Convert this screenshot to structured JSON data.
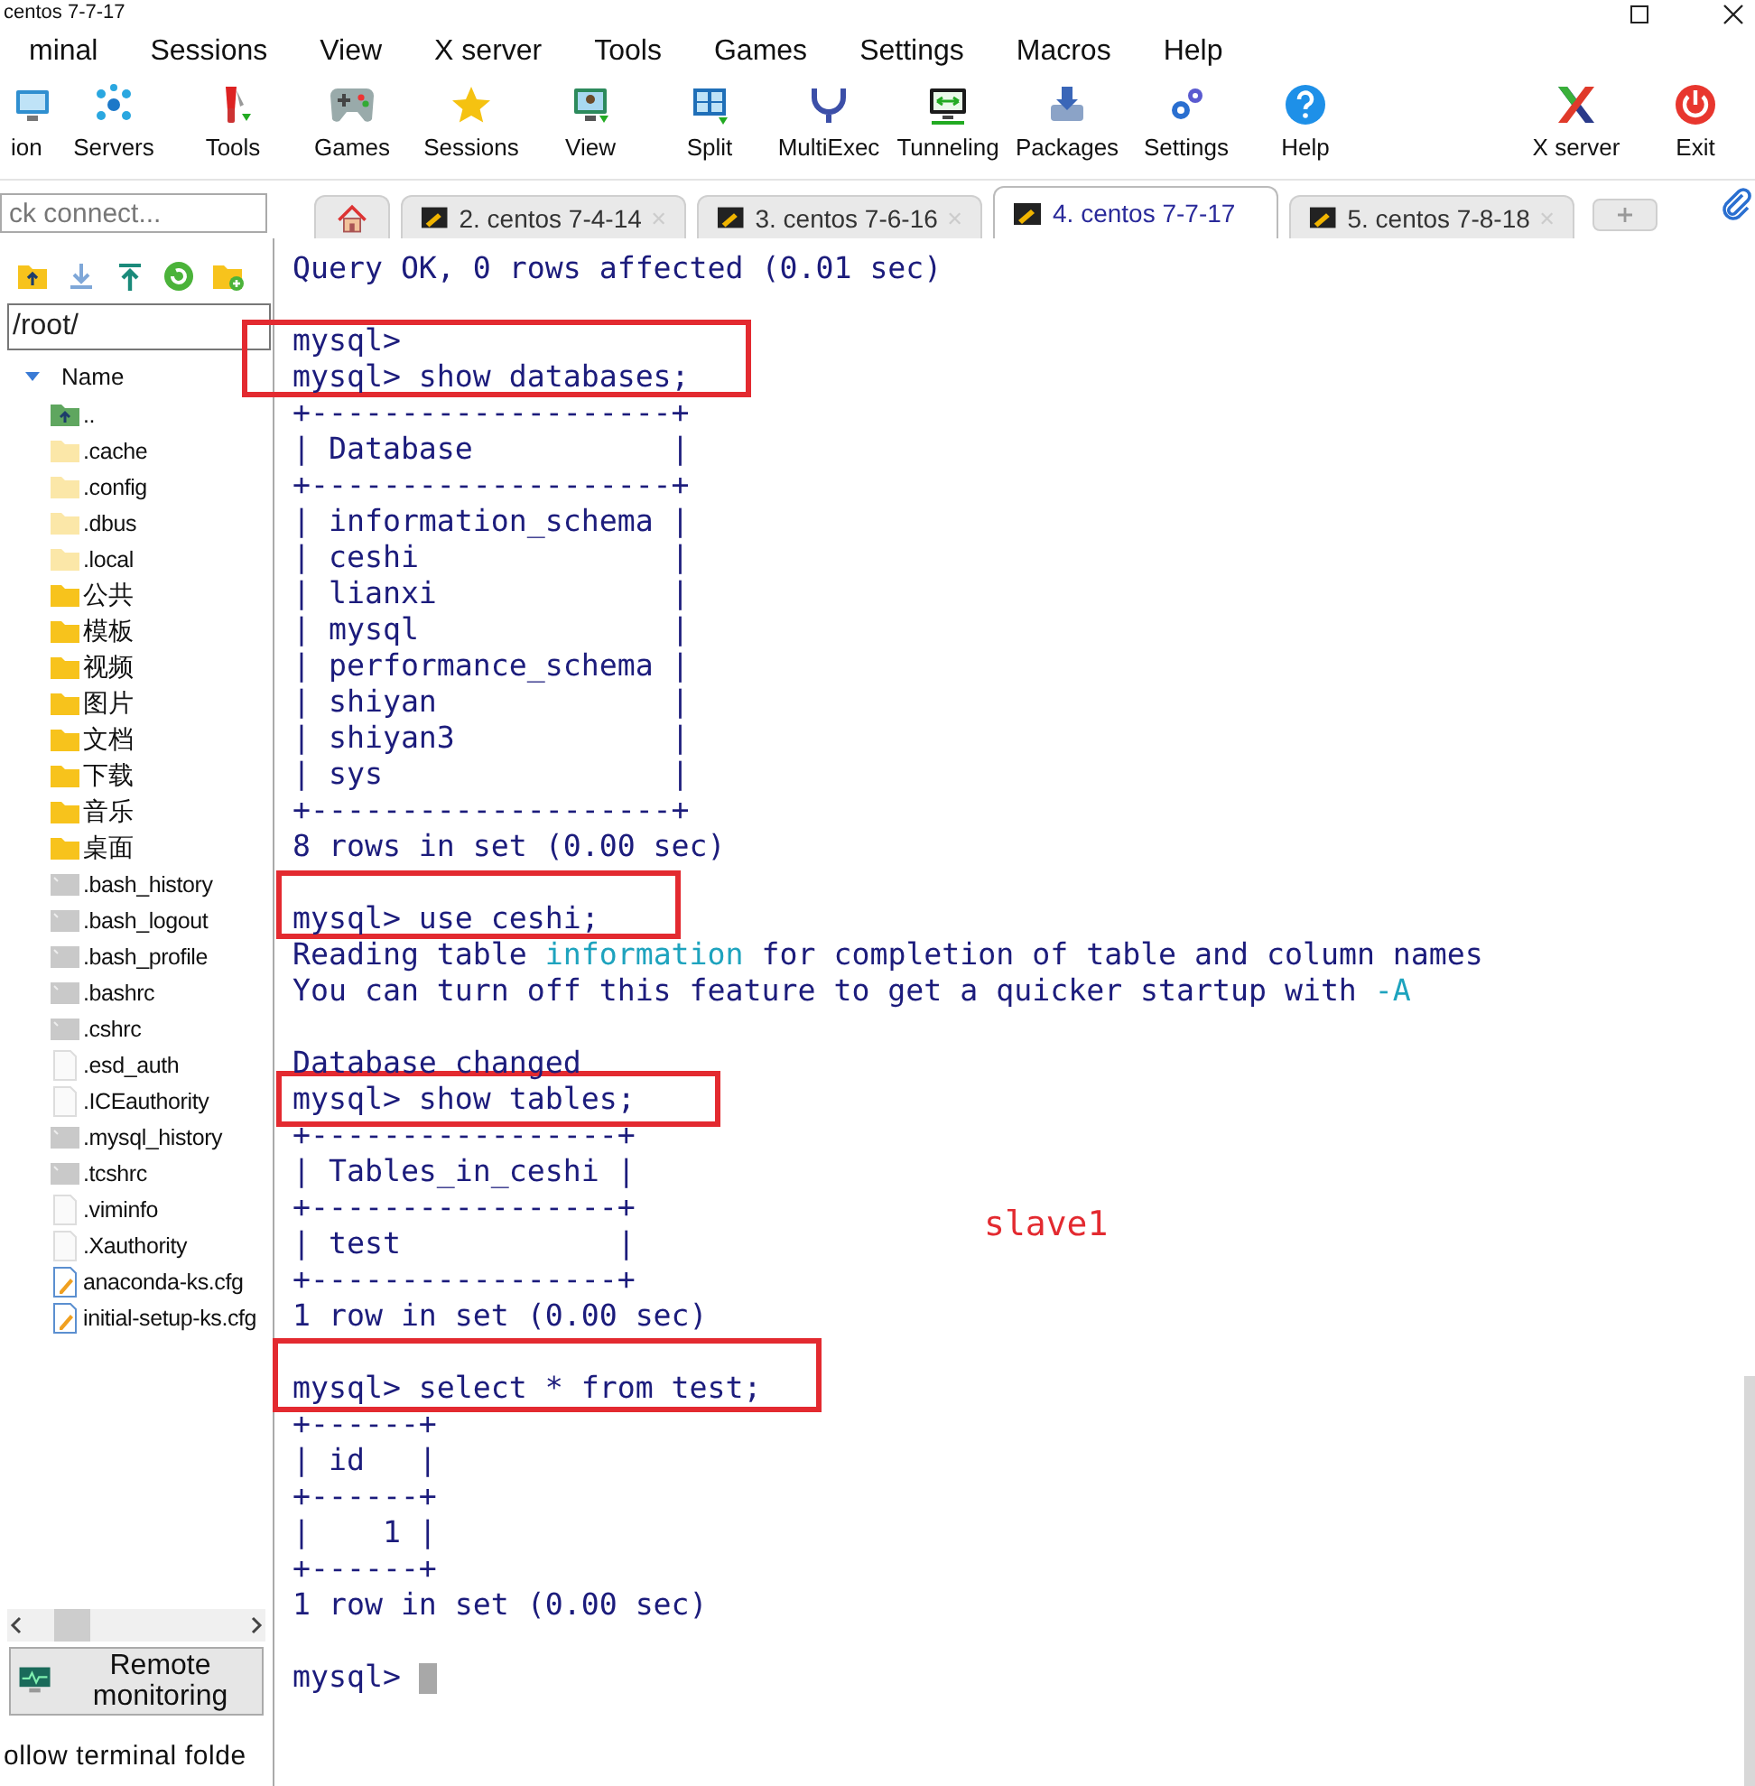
{
  "window": {
    "title": "centos 7-7-17"
  },
  "menu": [
    "minal",
    "Sessions",
    "View",
    "X server",
    "Tools",
    "Games",
    "Settings",
    "Macros",
    "Help"
  ],
  "toolbar": [
    {
      "label": "ion"
    },
    {
      "label": "Servers"
    },
    {
      "label": "Tools"
    },
    {
      "label": "Games"
    },
    {
      "label": "Sessions"
    },
    {
      "label": "View"
    },
    {
      "label": "Split"
    },
    {
      "label": "MultiExec"
    },
    {
      "label": "Tunneling"
    },
    {
      "label": "Packages"
    },
    {
      "label": "Settings"
    },
    {
      "label": "Help"
    },
    {
      "label": "X server"
    },
    {
      "label": "Exit"
    }
  ],
  "quick_connect": {
    "placeholder": "ck connect..."
  },
  "tabs": [
    {
      "kind": "home",
      "selected": false
    },
    {
      "kind": "session",
      "label": "2. centos 7-4-14",
      "selected": false
    },
    {
      "kind": "session",
      "label": "3. centos 7-6-16",
      "selected": false
    },
    {
      "kind": "session",
      "label": "4. centos 7-7-17",
      "selected": true
    },
    {
      "kind": "session",
      "label": "5. centos 7-8-18",
      "selected": false
    },
    {
      "kind": "new",
      "selected": false
    }
  ],
  "sidebar": {
    "path": "/root/",
    "column": "Name",
    "files": [
      {
        "name": "..",
        "kind": "up"
      },
      {
        "name": ".cache",
        "kind": "hidden-folder"
      },
      {
        "name": ".config",
        "kind": "hidden-folder"
      },
      {
        "name": ".dbus",
        "kind": "hidden-folder"
      },
      {
        "name": ".local",
        "kind": "hidden-folder"
      },
      {
        "name": "公共",
        "kind": "folder"
      },
      {
        "name": "模板",
        "kind": "folder"
      },
      {
        "name": "视频",
        "kind": "folder"
      },
      {
        "name": "图片",
        "kind": "folder"
      },
      {
        "name": "文档",
        "kind": "folder"
      },
      {
        "name": "下载",
        "kind": "folder"
      },
      {
        "name": "音乐",
        "kind": "folder"
      },
      {
        "name": "桌面",
        "kind": "folder"
      },
      {
        "name": ".bash_history",
        "kind": "script"
      },
      {
        "name": ".bash_logout",
        "kind": "script"
      },
      {
        "name": ".bash_profile",
        "kind": "script"
      },
      {
        "name": ".bashrc",
        "kind": "script"
      },
      {
        "name": ".cshrc",
        "kind": "script"
      },
      {
        "name": ".esd_auth",
        "kind": "blank"
      },
      {
        "name": ".ICEauthority",
        "kind": "blank"
      },
      {
        "name": ".mysql_history",
        "kind": "script"
      },
      {
        "name": ".tcshrc",
        "kind": "script"
      },
      {
        "name": ".viminfo",
        "kind": "blank"
      },
      {
        "name": ".Xauthority",
        "kind": "blank"
      },
      {
        "name": "anaconda-ks.cfg",
        "kind": "config"
      },
      {
        "name": "initial-setup-ks.cfg",
        "kind": "config"
      }
    ],
    "remote_monitoring": "Remote monitoring",
    "follow_folder": "ollow terminal folde"
  },
  "terminal": {
    "lines": [
      {
        "kind": "text",
        "text": "Query OK, 0 rows affected (0.01 sec)"
      },
      {
        "kind": "blank"
      },
      {
        "kind": "text",
        "text": "mysql>"
      },
      {
        "kind": "text",
        "text": "mysql> show databases;"
      },
      {
        "kind": "text",
        "text": "+--------------------+"
      },
      {
        "kind": "text",
        "text": "| Database           |"
      },
      {
        "kind": "text",
        "text": "+--------------------+"
      },
      {
        "kind": "text",
        "text": "| information_schema |"
      },
      {
        "kind": "text",
        "text": "| ceshi              |"
      },
      {
        "kind": "text",
        "text": "| lianxi             |"
      },
      {
        "kind": "text",
        "text": "| mysql              |"
      },
      {
        "kind": "text",
        "text": "| performance_schema |"
      },
      {
        "kind": "text",
        "text": "| shiyan             |"
      },
      {
        "kind": "text",
        "text": "| shiyan3            |"
      },
      {
        "kind": "text",
        "text": "| sys                |"
      },
      {
        "kind": "text",
        "text": "+--------------------+"
      },
      {
        "kind": "text",
        "text": "8 rows in set (0.00 sec)"
      },
      {
        "kind": "blank"
      },
      {
        "kind": "text",
        "text": "mysql> use ceshi;"
      },
      {
        "kind": "segments",
        "segments": [
          {
            "text": "Reading table ",
            "kind": "plain"
          },
          {
            "text": "information",
            "kind": "highlight"
          },
          {
            "text": " for completion of table and column names",
            "kind": "plain"
          }
        ]
      },
      {
        "kind": "segments",
        "segments": [
          {
            "text": "You can turn off this feature to get a quicker startup with ",
            "kind": "plain"
          },
          {
            "text": "-A",
            "kind": "highlight"
          }
        ]
      },
      {
        "kind": "blank"
      },
      {
        "kind": "text",
        "text": "Database changed"
      },
      {
        "kind": "text",
        "text": "mysql> show tables;"
      },
      {
        "kind": "text",
        "text": "+-----------------+"
      },
      {
        "kind": "text",
        "text": "| Tables_in_ceshi |"
      },
      {
        "kind": "text",
        "text": "+-----------------+"
      },
      {
        "kind": "text",
        "text": "| test            |"
      },
      {
        "kind": "text",
        "text": "+-----------------+"
      },
      {
        "kind": "text",
        "text": "1 row in set (0.00 sec)"
      },
      {
        "kind": "blank"
      },
      {
        "kind": "text",
        "text": "mysql> select * from test;"
      },
      {
        "kind": "text",
        "text": "+------+"
      },
      {
        "kind": "text",
        "text": "| id   |"
      },
      {
        "kind": "text",
        "text": "+------+"
      },
      {
        "kind": "text",
        "text": "|    1 |"
      },
      {
        "kind": "text",
        "text": "+------+"
      },
      {
        "kind": "text",
        "text": "1 row in set (0.00 sec)"
      },
      {
        "kind": "blank"
      },
      {
        "kind": "text",
        "text": "mysql>",
        "cursor": true
      }
    ],
    "annotations": [
      {
        "kind": "box"
      },
      {
        "kind": "box"
      },
      {
        "kind": "box"
      },
      {
        "kind": "box"
      },
      {
        "kind": "label",
        "text": "slave1"
      }
    ]
  }
}
